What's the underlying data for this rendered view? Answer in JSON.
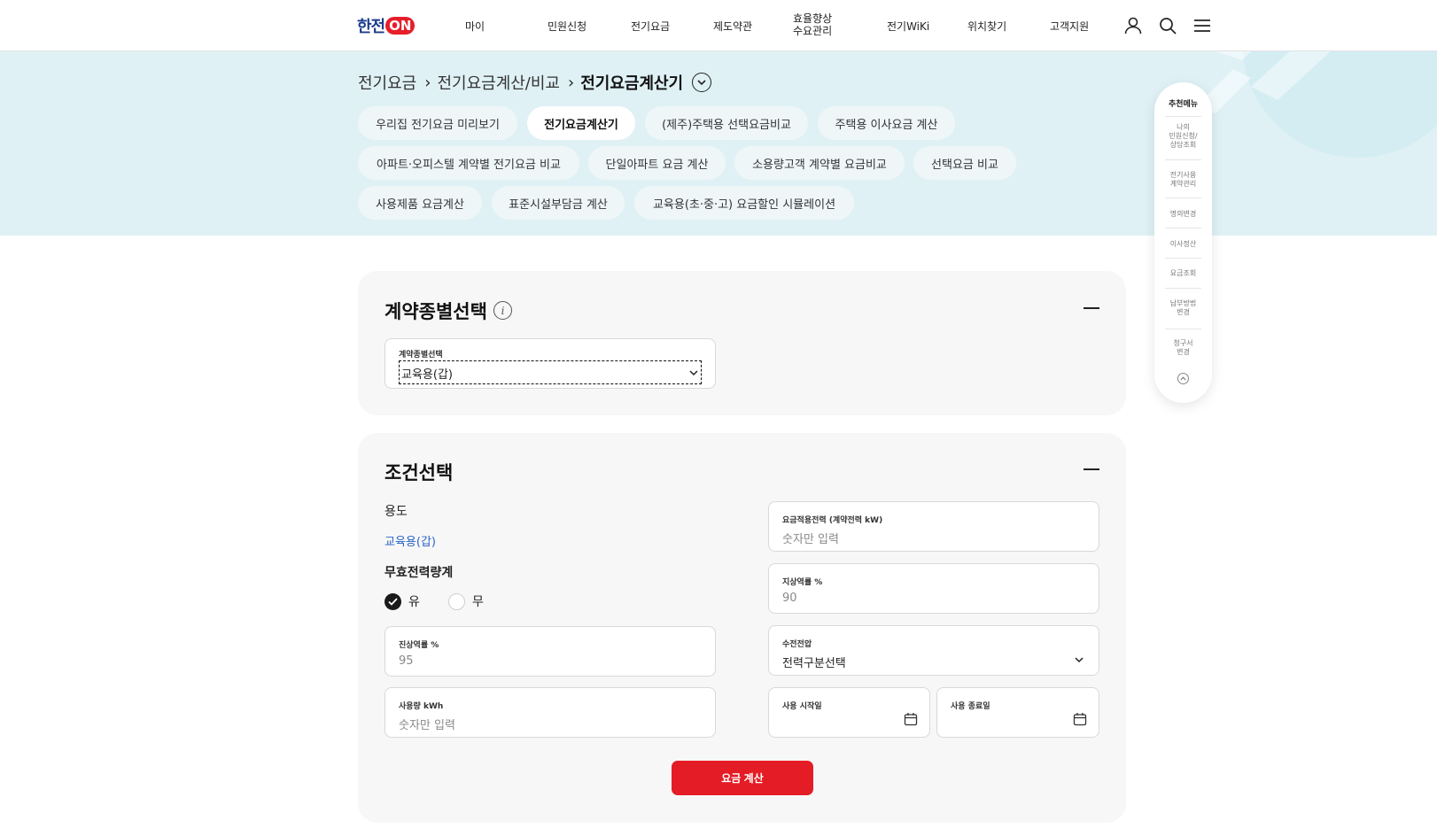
{
  "header": {
    "logo_text": "한전",
    "logo_on": "ON",
    "nav": [
      "마이",
      "민원신청",
      "전기요금",
      "제도약관",
      "효율향상\n수요관리",
      "전기WiKi",
      "위치찾기",
      "고객지원"
    ],
    "icons": [
      "user-icon",
      "search-icon",
      "menu-icon"
    ]
  },
  "breadcrumb": {
    "items": [
      "전기요금",
      "전기요금계산/비교",
      "전기요금계산기"
    ]
  },
  "chips": [
    "우리집 전기요금 미리보기",
    "전기요금계산기",
    "(제주)주택용 선택요금비교",
    "주택용 이사요금 계산",
    "아파트·오피스텔 계약별 전기요금 비교",
    "단일아파트 요금 계산",
    "소용량고객 계약별 요금비교",
    "선택요금 비교",
    "사용제품 요금계산",
    "표준시설부담금 계산",
    "교육용(초·중·고) 요금할인 시뮬레이션"
  ],
  "quick_menu": {
    "title": "추천메뉴",
    "items": [
      "나의\n민원신청/\n상담조회",
      "전기사용\n계약관리",
      "명의변경",
      "이사정산",
      "요금조회",
      "납부방법\n변경",
      "청구서\n변경"
    ]
  },
  "contract": {
    "title": "계약종별선택",
    "select_label": "계약종별선택",
    "select_value": "교육용(갑)"
  },
  "conditions": {
    "title": "조건선택",
    "usage_label": "용도",
    "usage_value": "교육용(갑)",
    "reactive_label": "무효전력량계",
    "radio_yes": "유",
    "radio_no": "무",
    "lag_label": "진상역률 %",
    "lag_value": "95",
    "kwh_label": "사용량 kWh",
    "kwh_placeholder": "숫자만 입력",
    "power_label": "요금적용전력 (계약전력 kW)",
    "power_placeholder": "숫자만 입력",
    "lead_label": "지상역률 %",
    "lead_value": "90",
    "voltage_label": "수전전압",
    "voltage_value": "전력구분선택",
    "start_label": "사용 시작일",
    "end_label": "사용 종료일",
    "submit": "요금 계산"
  },
  "colors": {
    "accent_red": "#e41c25",
    "hero_bg": "#dff1f5",
    "link_blue": "#2a64c8",
    "logo_blue": "#1b3c8c"
  }
}
